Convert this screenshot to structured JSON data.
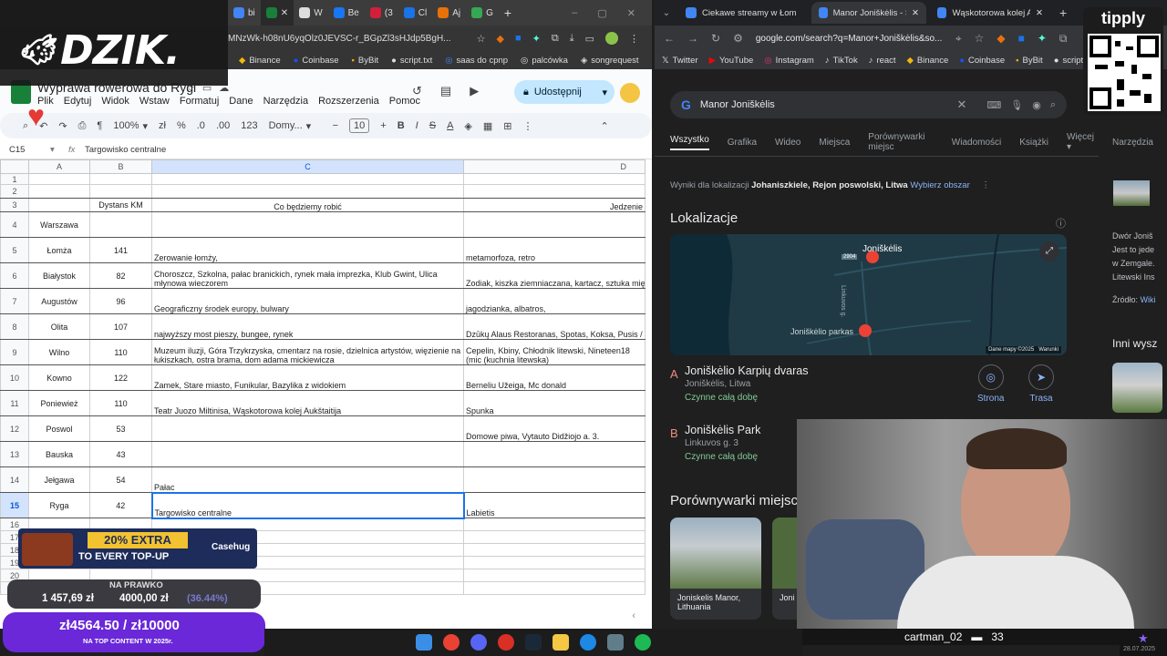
{
  "left_browser": {
    "tabs": [
      "bi",
      "",
      "W",
      "Be",
      "(3",
      "Cl",
      "Aj",
      "G"
    ],
    "url": "MNzWk-h08nU6yqOlz0JEVSC-r_BGpZl3sHJdp5BgH...",
    "bookmarks": [
      "Binance",
      "Coinbase",
      "ByBit",
      "script.txt",
      "saas do cpnp",
      "palcówka",
      "songrequest"
    ]
  },
  "sheet": {
    "title": "Wyprawa rowerowa do Rygi",
    "menu": [
      "Plik",
      "Edytuj",
      "Widok",
      "Wstaw",
      "Formatuj",
      "Dane",
      "Narzędzia",
      "Rozszerzenia",
      "Pomoc"
    ],
    "share_label": "Udostępnij",
    "zoom": "100%",
    "font_name": "Domy...",
    "font_size": "10",
    "cell_ref": "C15",
    "formula_value": "Targowisko centralne",
    "columns": [
      "A",
      "B",
      "C",
      "D"
    ],
    "header_row": {
      "b": "Dystans KM",
      "c": "Co będziemy robić",
      "d": "Jedzenie"
    },
    "rows": [
      {
        "n": "1",
        "a": "",
        "b": "",
        "c": "",
        "d": ""
      },
      {
        "n": "2",
        "a": "",
        "b": "",
        "c": "",
        "d": ""
      },
      {
        "n": "4",
        "a": "Warszawa",
        "b": "",
        "c": "",
        "d": ""
      },
      {
        "n": "5",
        "a": "Łomża",
        "b": "141",
        "c": "Zerowanie łomży,",
        "d": "metamorfoza, retro"
      },
      {
        "n": "6",
        "a": "Białystok",
        "b": "82",
        "c": "Choroszcz, Szkolna, pałac branickich, rynek mała imprezka, Klub Gwint, Ulica młynowa wieczorem",
        "d": "Zodiak, kiszka ziemniaczana, kartacz, sztuka mięs"
      },
      {
        "n": "7",
        "a": "Augustów",
        "b": "96",
        "c": "Geograficzny środek europy, bulwary",
        "d": "jagodzianka, albatros,"
      },
      {
        "n": "8",
        "a": "Olita",
        "b": "107",
        "c": "najwyższy most pieszy, bungee, rynek",
        "d": "Dzūkų Alaus Restoranas, Spotas, Koksa, Pusis / F"
      },
      {
        "n": "9",
        "a": "Wilno",
        "b": "110",
        "c": "Muzeum iluzji, Góra Trzykrzyska, cmentarz na rosie, dzielnica artystów, więzienie na łukiszkach, ostra brama, dom adama mickiewicza",
        "d": "Cepelin, Kbiny, Chłodnik litewski, Nineteen18 (mic (kuchnia litewska)"
      },
      {
        "n": "10",
        "a": "Kowno",
        "b": "122",
        "c": "Zamek, Stare miasto, Funikular, Bazylika z widokiem",
        "d": "Berneliu Užeiga, Mc donald"
      },
      {
        "n": "11",
        "a": "Poniewież",
        "b": "110",
        "c": "Teatr Juozo Miltinisa, Wąskotorowa kolej Aukštaitija",
        "d": "Spunka"
      },
      {
        "n": "12",
        "a": "Poswol",
        "b": "53",
        "c": "",
        "d": "Domowe piwa, Vytauto Didžiojo a. 3."
      },
      {
        "n": "13",
        "a": "Bauska",
        "b": "43",
        "c": "",
        "d": ""
      },
      {
        "n": "14",
        "a": "Jełgawa",
        "b": "54",
        "c": "Pałac",
        "d": ""
      },
      {
        "n": "15",
        "a": "Ryga",
        "b": "42",
        "c": "Targowisko centralne",
        "d": "Labietis"
      },
      {
        "n": "16",
        "a": "",
        "b": "",
        "c": "",
        "d": ""
      },
      {
        "n": "17",
        "a": "",
        "b": "",
        "c": "",
        "d": ""
      },
      {
        "n": "18",
        "a": "",
        "b": "",
        "c": "",
        "d": ""
      },
      {
        "n": "19",
        "a": "",
        "b": "",
        "c": "",
        "d": ""
      },
      {
        "n": "20",
        "a": "",
        "b": "",
        "c": "",
        "d": ""
      },
      {
        "n": "21",
        "a": "",
        "b": "",
        "c": "",
        "d": ""
      }
    ]
  },
  "right_browser": {
    "tabs": [
      "Ciekawe streamy w Łom",
      "Manor Joniškėlis - Szuk",
      "Wąskotorowa kolej Auk"
    ],
    "url": "google.com/search?q=Manor+Joniškėlis&so...",
    "bookmarks": [
      "Twitter",
      "YouTube",
      "Instagram",
      "TikTok",
      "react",
      "Binance",
      "Coinbase",
      "ByBit",
      "script.txt"
    ]
  },
  "google": {
    "query": "Manor Joniškėlis",
    "tabs": [
      "Wszystko",
      "Grafika",
      "Wideo",
      "Miejsca",
      "Porównywarki miejsc",
      "Wiadomości",
      "Książki",
      "Więcej"
    ],
    "tools": "Narzędzia",
    "location_prefix": "Wyniki dla lokalizacji",
    "location": "Johaniszkiele, Rejon poswolski, Litwa",
    "location_link": "Wybierz obszar",
    "section_title": "Lokalizacje",
    "map_label_town": "Joniškėlis",
    "map_label_park": "Joniškėlio parkas",
    "map_label_road": "Linkuvos g.",
    "map_label_route": "2904",
    "map_credit": "Dane mapy ©2025",
    "map_terms": "Warunki",
    "results": [
      {
        "letter": "A",
        "title": "Joniškėlio Karpių dvaras",
        "sub": "Joniškėlis, Litwa",
        "status": "Czynne całą dobę"
      },
      {
        "letter": "B",
        "title": "Joniškėlis Park",
        "sub": "Linkuvos g. 3",
        "status": "Czynne całą dobę"
      }
    ],
    "btn_site": "Strona",
    "btn_route": "Trasa",
    "compare_title": "Porównywarki miejsc",
    "cards": [
      {
        "label": "Joniskelis Manor, Lithuania"
      },
      {
        "label": "Joni Serv"
      }
    ],
    "side_texts": [
      "Dwór Joniš",
      "Jest to jede",
      "w Zemgale.",
      "Litewski Ins"
    ],
    "side_source": "Źródło:",
    "side_source_link": "Wiki",
    "side_more": "Inni wysz"
  },
  "overlay": {
    "logo": "DZIK.",
    "tipply": "tipply",
    "promo_main": "20% EXTRA",
    "promo_sub": "TO EVERY TOP-UP",
    "promo_brand": "Casehug",
    "goal_label": "NA PRAWKO",
    "goal_current": "1 457,69 zł",
    "goal_target": "4000,00 zł",
    "goal_percent": "(36.44%)",
    "goal2_current": "zł4564.50",
    "goal2_sep": " / ",
    "goal2_target": "zł10000",
    "goal2_label": "NA TOP CONTENT W 2025r.",
    "cam_name": "cartman_02",
    "cam_count": "33",
    "clock_date": "28.07.2025"
  }
}
